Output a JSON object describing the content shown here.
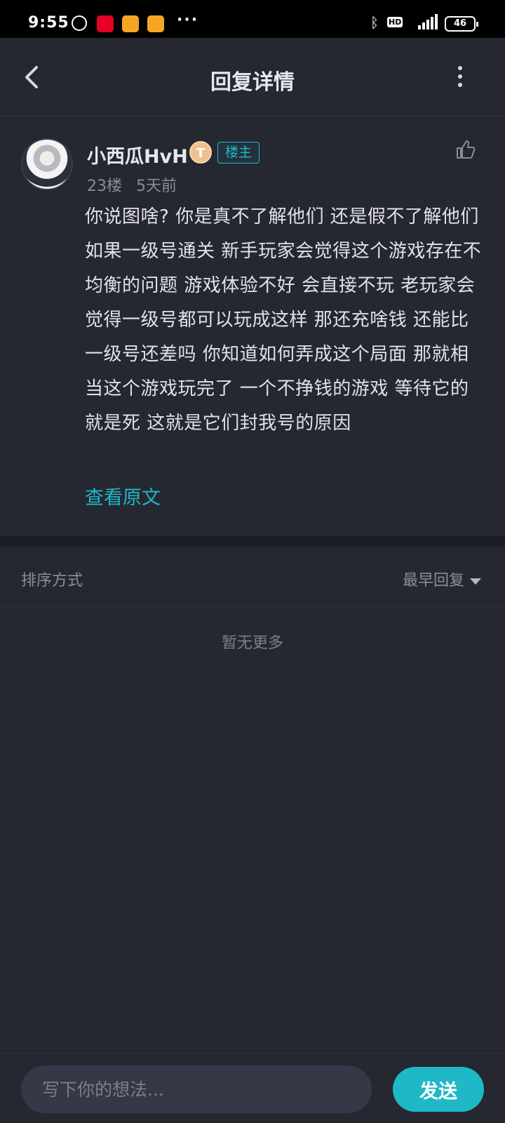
{
  "status_bar": {
    "time": "9:55",
    "more": "···",
    "hd": "HD",
    "battery": "46"
  },
  "header": {
    "title": "回复详情"
  },
  "post": {
    "username": "小西瓜HvH",
    "user_badge": "T",
    "op_tag": "楼主",
    "floor": "23楼",
    "time": "5天前",
    "content": "你说图啥? 你是真不了解他们 还是假不了解他们 如果一级号通关 新手玩家会觉得这个游戏存在不均衡的问题 游戏体验不好 会直接不玩 老玩家会觉得一级号都可以玩成这样 那还充啥钱 还能比一级号还差吗 你知道如何弄成这个局面 那就相当这个游戏玩完了 一个不挣钱的游戏 等待它的就是死 这就是它们封我号的原因",
    "view_original": "查看原文"
  },
  "sort": {
    "label": "排序方式",
    "selected": "最早回复"
  },
  "empty_text": "暂无更多",
  "composer": {
    "placeholder": "写下你的想法...",
    "send_label": "发送"
  },
  "colors": {
    "background": "#252731",
    "accent": "#1fb8c6",
    "text_primary": "#e2e2e6",
    "text_secondary": "#8a8c96"
  }
}
